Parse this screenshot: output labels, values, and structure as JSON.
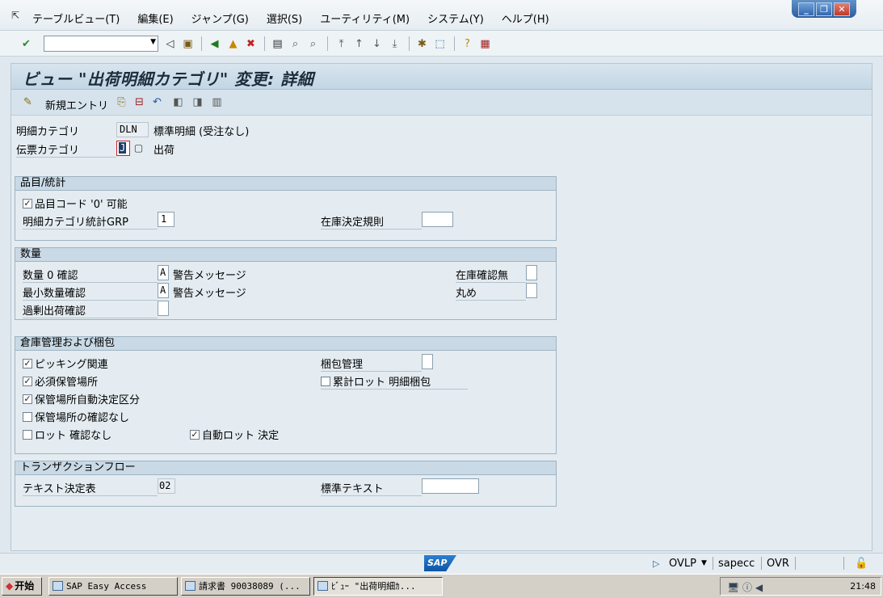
{
  "menubar": {
    "items": [
      "テーブルビュー(T)",
      "編集(E)",
      "ジャンプ(G)",
      "選択(S)",
      "ユーティリティ(M)",
      "システム(Y)",
      "ヘルプ(H)"
    ],
    "window_buttons": [
      "_",
      "❐",
      "✕"
    ]
  },
  "toolbar": {
    "command_field_value": ""
  },
  "screen": {
    "title": "ビュー \"出荷明細カテゴリ\" 変更: 詳細",
    "app_toolbar": {
      "new_entries_label": "新規エントリ"
    },
    "header": {
      "item_category_label": "明細カテゴリ",
      "item_category_value": "DLN",
      "item_category_desc": "標準明細 (受注なし)",
      "doc_category_label": "伝票カテゴリ",
      "doc_category_value": "J",
      "doc_category_desc": "出荷"
    },
    "group_material": {
      "title": "品目/統計",
      "mat_zero_label": "品目コード '0' 可能",
      "mat_zero_checked": true,
      "stat_grp_label": "明細カテゴリ統計GRP",
      "stat_grp_value": "1",
      "stock_rule_label": "在庫決定規則",
      "stock_rule_value": ""
    },
    "group_quantity": {
      "title": "数量",
      "qty0_label": "数量 0 確認",
      "qty0_value": "A",
      "qty0_desc": "警告メッセージ",
      "minqty_label": "最小数量確認",
      "minqty_value": "A",
      "minqty_desc": "警告メッセージ",
      "overdel_label": "過剰出荷確認",
      "overdel_value": "",
      "nostock_label": "在庫確認無",
      "nostock_value": "",
      "rounding_label": "丸め",
      "rounding_value": ""
    },
    "group_warehouse": {
      "title": "倉庫管理および梱包",
      "picking_label": "ピッキング関連",
      "picking_checked": true,
      "sloc_req_label": "必須保管場所",
      "sloc_req_checked": true,
      "sloc_auto_label": "保管場所自動決定区分",
      "sloc_auto_checked": true,
      "sloc_nocheck_label": "保管場所の確認なし",
      "sloc_nocheck_checked": false,
      "lot_nocheck_label": "ロット 確認なし",
      "lot_nocheck_checked": false,
      "auto_lot_label": "自動ロット 決定",
      "auto_lot_checked": true,
      "packing_ctrl_label": "梱包管理",
      "packing_ctrl_value": "",
      "cum_batch_label": "累計ロット 明細梱包",
      "cum_batch_checked": false
    },
    "group_transaction": {
      "title": "トランザクションフロー",
      "text_det_label": "テキスト決定表",
      "text_det_value": "02",
      "std_text_label": "標準テキスト",
      "std_text_value": ""
    }
  },
  "status": {
    "logo": "SAP",
    "mode": "OVLP",
    "server": "sapecc",
    "ovr": "OVR"
  },
  "taskbar": {
    "start": "开始",
    "tasks": [
      "SAP Easy Access",
      "請求書 90038089   (...",
      "ﾋﾞｭｰ \"出荷明細ｶ..."
    ],
    "time": "21:48"
  }
}
